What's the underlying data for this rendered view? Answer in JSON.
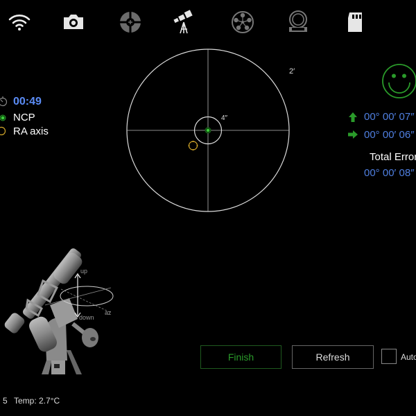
{
  "toolbar": {
    "items": [
      {
        "name": "wifi-icon",
        "label": "WiFi"
      },
      {
        "name": "camera-icon",
        "label": "Camera"
      },
      {
        "name": "crosshair-icon",
        "label": "Focus"
      },
      {
        "name": "telescope-icon",
        "label": "Telescope"
      },
      {
        "name": "filter-wheel-icon",
        "label": "Filter Wheel"
      },
      {
        "name": "focuser-icon",
        "label": "Focuser"
      },
      {
        "name": "sd-card-icon",
        "label": "Storage"
      }
    ]
  },
  "legend": {
    "timer": "00:49",
    "ncp_label": "NCP",
    "ra_axis_label": "RA axis"
  },
  "target": {
    "outer_scale_label": "2′",
    "inner_scale_label": "4″"
  },
  "error_panel": {
    "status": "good",
    "altitude_error": "00° 00′ 07″",
    "azimuth_error": "00° 00′ 06″",
    "total_error_label": "Total Error",
    "total_error": "00° 00′ 08″"
  },
  "mount_diagram": {
    "up_label": "up",
    "down_label": "down",
    "az_label": "az"
  },
  "actions": {
    "finish_label": "Finish",
    "refresh_label": "Refresh",
    "auto_label": "Auto Refresh",
    "auto_checked": false
  },
  "status_bar": {
    "prefix": "5",
    "temp": "Temp: 2.7°C"
  },
  "colors": {
    "accent_blue": "#5b8cf5",
    "good_green": "#2a9a2a",
    "ra_axis_yellow": "#d4a82a"
  }
}
